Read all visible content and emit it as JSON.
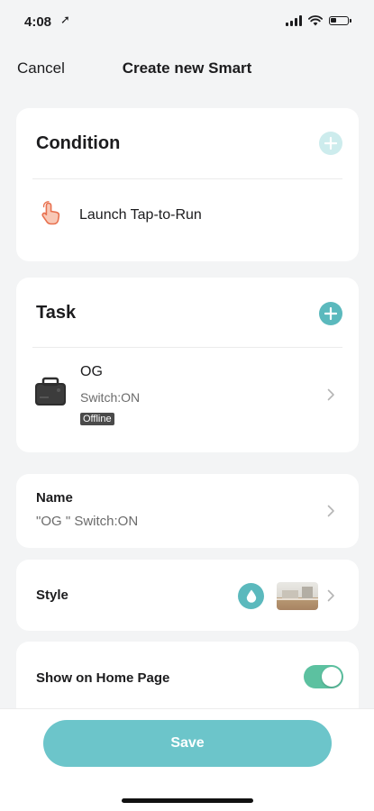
{
  "status_bar": {
    "time": "4:08",
    "location_arrow": "➚"
  },
  "nav": {
    "cancel_label": "Cancel",
    "title": "Create new Smart"
  },
  "condition": {
    "title": "Condition",
    "item_label": "Launch Tap-to-Run",
    "item_icon": "tap-hand-icon"
  },
  "task": {
    "title": "Task",
    "device_name": "OG",
    "device_status": "Switch:ON",
    "badge": "Offline"
  },
  "name_section": {
    "label": "Name",
    "value": "\"OG \" Switch:ON"
  },
  "style_section": {
    "label": "Style",
    "icon": "water-drop-icon"
  },
  "home_page": {
    "label": "Show on Home Page",
    "enabled": true
  },
  "save": {
    "label": "Save"
  },
  "colors": {
    "accent": "#5bb9bd",
    "add_inactive": "#cdeced",
    "toggle_on": "#5cc1a0",
    "save_button": "#6cc5ca",
    "tap_icon": "#e8714f"
  }
}
